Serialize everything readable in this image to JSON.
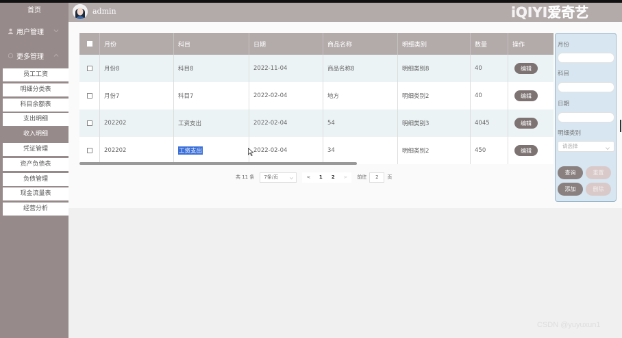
{
  "sidebar": {
    "home": "首页",
    "groups": [
      {
        "label": "用户管理"
      },
      {
        "label": "更多管理"
      }
    ],
    "items": [
      {
        "label": "员工工资"
      },
      {
        "label": "明细分类表"
      },
      {
        "label": "科目余额表"
      },
      {
        "label": "支出明细"
      },
      {
        "label": "收入明细"
      },
      {
        "label": "凭证管理"
      },
      {
        "label": "资产负债表"
      },
      {
        "label": "负债管理"
      },
      {
        "label": "现金流量表"
      },
      {
        "label": "经营分析"
      }
    ],
    "active_index": 4
  },
  "header": {
    "username": "admin",
    "logo_text": "iQIYI爱奇艺"
  },
  "table": {
    "columns": [
      "月份",
      "科目",
      "日期",
      "商品名称",
      "明细类别",
      "数量",
      "操作"
    ],
    "rows": [
      {
        "month": "月份8",
        "subject": "科目8",
        "date": "2022-11-04",
        "product": "商品名称8",
        "category": "明细类别8",
        "qty": "40",
        "action": "编辑"
      },
      {
        "month": "月份7",
        "subject": "科目7",
        "date": "2022-02-04",
        "product": "地方",
        "category": "明细类别2",
        "qty": "40",
        "action": "编辑"
      },
      {
        "month": "202202",
        "subject": "工资支出",
        "date": "2022-02-04",
        "product": "54",
        "category": "明细类别3",
        "qty": "4045",
        "action": "编辑"
      },
      {
        "month": "202202",
        "subject": "工资支出",
        "date": "2022-02-04",
        "product": "34",
        "category": "明细类别2",
        "qty": "450",
        "action": "编辑"
      }
    ]
  },
  "pagination": {
    "total": "共 11 条",
    "page_size": "7条/页",
    "prev": "<",
    "pages": [
      "1",
      "2"
    ],
    "next": ">",
    "goto_prefix": "前往",
    "goto_value": "2",
    "goto_suffix": "页"
  },
  "search_panel": {
    "month_label": "月份",
    "subject_label": "科目",
    "date_label": "日期",
    "category_label": "明细类别",
    "category_placeholder": "请选择",
    "query_btn": "查询",
    "reset_btn": "重置",
    "add_btn": "添加",
    "delete_btn": "删除"
  },
  "watermark": "CSDN @yuyuxun1",
  "colors": {
    "sidebar": "#978a8a",
    "header": "#b3aaaa",
    "panel": "#d7e6f0",
    "button": "#7d7373"
  }
}
